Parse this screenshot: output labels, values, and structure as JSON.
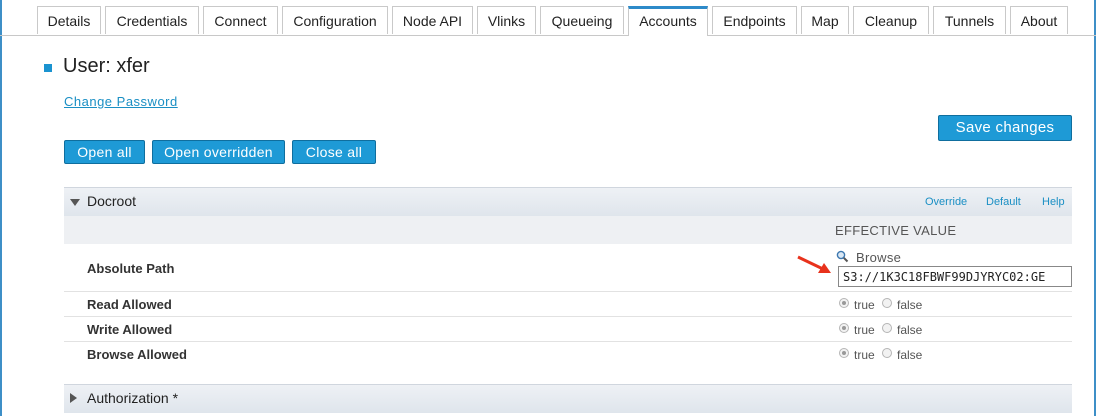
{
  "tabs": [
    {
      "label": "Details"
    },
    {
      "label": "Credentials"
    },
    {
      "label": "Connect"
    },
    {
      "label": "Configuration"
    },
    {
      "label": "Node API"
    },
    {
      "label": "Vlinks"
    },
    {
      "label": "Queueing"
    },
    {
      "label": "Accounts",
      "active": true
    },
    {
      "label": "Endpoints"
    },
    {
      "label": "Map"
    },
    {
      "label": "Cleanup"
    },
    {
      "label": "Tunnels"
    },
    {
      "label": "About"
    }
  ],
  "page": {
    "title": "User: xfer",
    "change_password": "Change Password",
    "save_changes": "Save changes",
    "open_all": "Open all",
    "open_overridden": "Open overridden",
    "close_all": "Close all"
  },
  "docroot": {
    "title": "Docroot",
    "override": "Override",
    "default": "Default",
    "help": "Help",
    "effective_value": "EFFECTIVE VALUE",
    "browse": "Browse",
    "rows": [
      {
        "label": "Absolute Path",
        "value": "S3://1K3C18FBWF99DJYRYC02:GE"
      },
      {
        "label": "Read Allowed",
        "true": "true",
        "false": "false",
        "selected": "true"
      },
      {
        "label": "Write Allowed",
        "true": "true",
        "false": "false",
        "selected": "true"
      },
      {
        "label": "Browse Allowed",
        "true": "true",
        "false": "false",
        "selected": "true"
      }
    ]
  },
  "authorization": {
    "title": "Authorization *"
  },
  "colors": {
    "accent": "#1e9ad6",
    "link": "#1a8fc4",
    "arrow": "#e8321c"
  },
  "icons": {
    "browse": "magnifier-icon",
    "annotation": "red-arrow-icon"
  }
}
